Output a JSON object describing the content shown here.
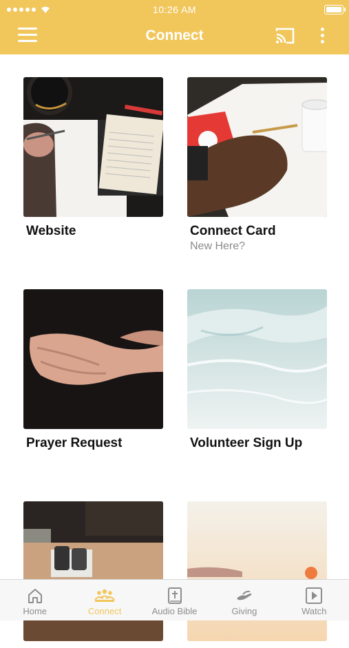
{
  "status": {
    "time": "10:26 AM"
  },
  "header": {
    "title": "Connect"
  },
  "tiles": [
    {
      "label": "Website",
      "sublabel": ""
    },
    {
      "label": "Connect Card",
      "sublabel": "New Here?"
    },
    {
      "label": "Prayer Request",
      "sublabel": ""
    },
    {
      "label": "Volunteer Sign Up",
      "sublabel": ""
    },
    {
      "label": "",
      "sublabel": ""
    },
    {
      "label": "",
      "sublabel": ""
    }
  ],
  "tabs": [
    {
      "label": "Home",
      "icon": "home-icon"
    },
    {
      "label": "Connect",
      "icon": "people-icon",
      "active": true
    },
    {
      "label": "Audio Bible",
      "icon": "bible-icon"
    },
    {
      "label": "Giving",
      "icon": "giving-hand-icon"
    },
    {
      "label": "Watch",
      "icon": "play-icon"
    }
  ],
  "colors": {
    "accent": "#f1c75c",
    "tab_inactive": "#8d8d8d"
  }
}
